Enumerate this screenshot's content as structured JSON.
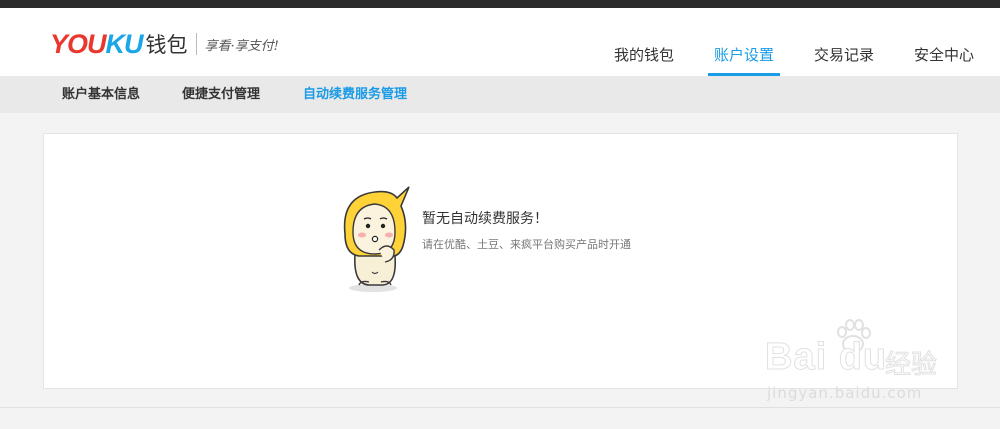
{
  "header": {
    "logo_youku_a": "YOU",
    "logo_youku_b": "KU",
    "logo_wallet": "钱包",
    "slogan": "享看·享支付!"
  },
  "nav": {
    "items": [
      {
        "label": "我的钱包"
      },
      {
        "label": "账户设置"
      },
      {
        "label": "交易记录"
      },
      {
        "label": "安全中心"
      }
    ],
    "active_index": 1
  },
  "subnav": {
    "items": [
      {
        "label": "账户基本信息"
      },
      {
        "label": "便捷支付管理"
      },
      {
        "label": "自动续费服务管理"
      }
    ],
    "active_index": 2
  },
  "empty_state": {
    "title": "暂无自动续费服务！",
    "subtitle": "请在优酷、土豆、来疯平台购买产品时开通",
    "mascot_icon": "youku-mascot-icon"
  },
  "watermark": {
    "brand": "Bai du",
    "brand_cn": "经验",
    "url": "jingyan.baidu.com"
  },
  "colors": {
    "accent": "#1a9be6",
    "logo_red": "#e9372e",
    "logo_blue": "#19a7e7"
  }
}
